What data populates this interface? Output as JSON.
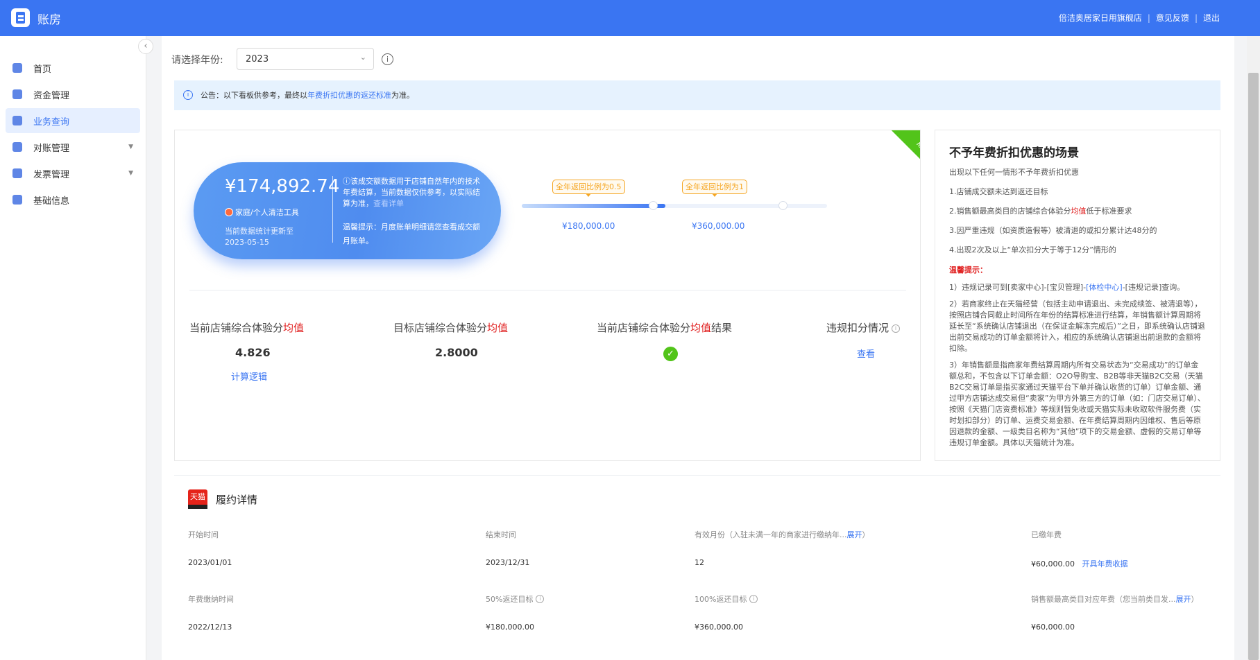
{
  "app": {
    "title": "账房"
  },
  "topbar": {
    "store": "倍洁奥居家日用旗舰店",
    "feedback": "意见反馈",
    "logout": "退出",
    "sep": "|"
  },
  "sidebar": {
    "items": [
      {
        "label": "首页",
        "icon": "home-icon"
      },
      {
        "label": "资金管理",
        "icon": "money-icon"
      },
      {
        "label": "业务查询",
        "icon": "folder-icon",
        "active": true
      },
      {
        "label": "对账管理",
        "icon": "reconcile-icon",
        "expandable": true
      },
      {
        "label": "发票管理",
        "icon": "invoice-icon",
        "expandable": true
      },
      {
        "label": "基础信息",
        "icon": "document-icon"
      }
    ]
  },
  "filter": {
    "label": "请选择年份:",
    "year": "2023"
  },
  "notice": {
    "prefix": "公告：以下看板供参考，最终以",
    "link": "年费折扣优惠的返还标准",
    "suffix": "为准。"
  },
  "status_ribbon": "履约中",
  "pill": {
    "amount": "¥174,892.74",
    "category": "家庭/个人清洁工具",
    "updated_label": "当前数据统计更新至",
    "updated_date": "2023-05-15",
    "desc": "ⓘ该成交额数据用于店铺自然年内的技术年费结算，当前数据仅供参考，以实际结算为准，",
    "desc_link": "查看详单",
    "tip": "温馨提示：月度账单明细请您查看成交额月账单。"
  },
  "progress": {
    "fraction": 0.47,
    "milestones": [
      {
        "tag": "全年返回比例为0.5",
        "amount": "¥180,000.00"
      },
      {
        "tag": "全年返回比例为1",
        "amount": "¥360,000.00"
      }
    ]
  },
  "metrics": {
    "current_title": "当前店铺综合体验分",
    "highlight": "均值",
    "current_value": "4.826",
    "calc_link": "计算逻辑",
    "target_title": "目标店铺综合体验分",
    "target_value": "2.8000",
    "result_title": "当前店铺综合体验分",
    "result_suffix": "结果",
    "violation_title": "违规扣分情况",
    "view_link": "查看"
  },
  "rules": {
    "title": "不予年费折扣优惠的场景",
    "intro": "出现以下任何一情形不予年费折扣优惠",
    "item1": "1.店铺成交额未达到返还目标",
    "item2a": "2.销售额最高类目的店铺综合体验分",
    "item2b": "均值",
    "item2c": "低于标准要求",
    "item3": "3.因严重违规（如资质造假等）被清退的或扣分累计达48分的",
    "item4": "4.出现2次及以上“单次扣分大于等于12分”情形的",
    "warm": "温馨提示：",
    "p1a": "1）违规记录可到[卖家中心]-[宝贝管理]-",
    "p1link": "[体检中心]",
    "p1b": "-[违规记录]查询。",
    "p2": "2）若商家终止在天猫经营（包括主动申请退出、未完成续签、被清退等），按照店铺合同截止时间所在年份的结算标准进行结算，年销售额计算周期将延长至“系统确认店铺退出（在保证金解冻完成后）”之日，即系统确认店铺退出前交易成功的订单金额将计入，相应的系统确认店铺退出前退款的金额将扣除。",
    "p3": "3）年销售额是指商家年费结算周期内所有交易状态为“交易成功”的订单金额总和，不包含以下订单金额：O2O导购宝、B2B等非天猫B2C交易（天猫B2C交易订单是指买家通过天猫平台下单并确认收货的订单）订单金额、通过甲方店铺达成交易但“卖家”为甲方外第三方的订单（如：门店交易订单）、按照《天猫门店资费标准》等规则暂免收或天猫实际未收取软件服务费（实时划扣部分）的订单、运费交易金额、在年费结算周期内因维权、售后等原因退款的金额、一级类目名称为“其他”项下的交易金额、虚假的交易订单等违规订单金额。具体以天猫统计为准。"
  },
  "detail": {
    "badge": "天猫",
    "title": "履约详情",
    "start_label": "开始时间",
    "start_value": "2023/01/01",
    "end_label": "结束时间",
    "end_value": "2023/12/31",
    "months_label": "有效月份（入驻未满一年的商家进行缴纳年...",
    "months_expand": "展开",
    "months_close": "）",
    "months_value": "12",
    "paid_label": "已缴年费",
    "paid_value": "¥60,000.00",
    "receipt_link": "开具年费收据",
    "pay_time_label": "年费缴纳时间",
    "pay_time_value": "2022/12/13",
    "target50_label": "50%返还目标",
    "target50_value": "¥180,000.00",
    "target100_label": "100%返还目标",
    "target100_value": "¥360,000.00",
    "top_cat_label": "销售额最高类目对应年费（您当前类目发...",
    "top_cat_expand": "展开",
    "top_cat_close": "）",
    "top_cat_value": "¥60,000.00"
  },
  "colors": {
    "primary": "#3a75f2",
    "success": "#52c41a",
    "warning": "#f5a623",
    "danger": "#e02020"
  }
}
